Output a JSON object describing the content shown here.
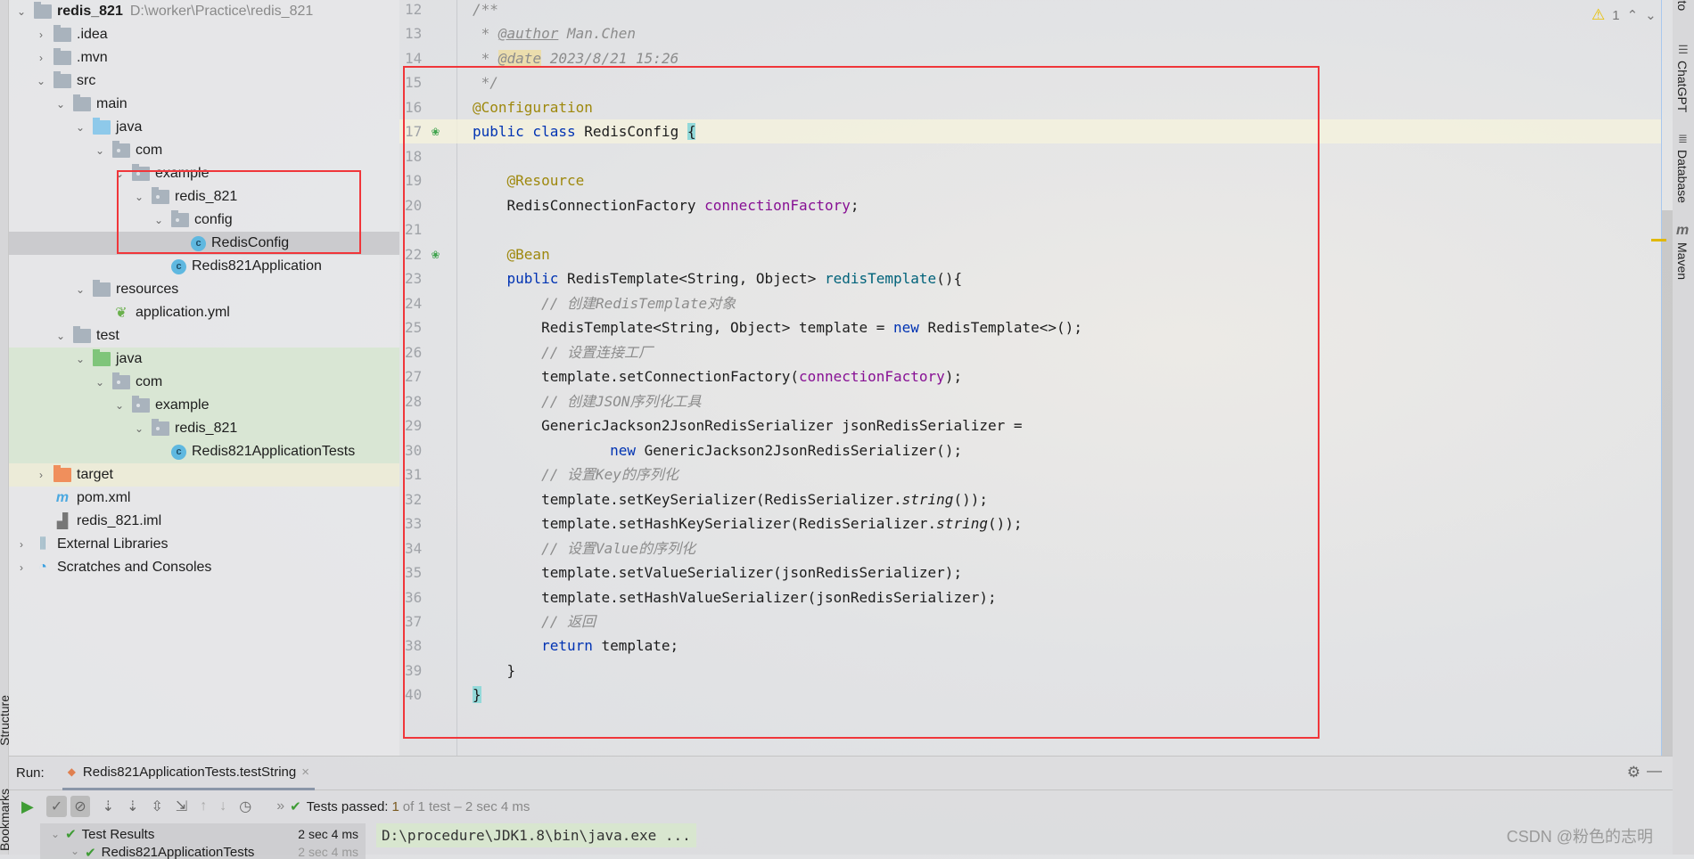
{
  "project_tree": [
    {
      "level": 0,
      "arrow": "open",
      "icon": "project",
      "label": "redis_821",
      "bold": true,
      "path": "D:\\worker\\Practice\\redis_821"
    },
    {
      "level": 1,
      "arrow": "closed",
      "icon": "folder",
      "label": ".idea"
    },
    {
      "level": 1,
      "arrow": "closed",
      "icon": "folder",
      "label": ".mvn"
    },
    {
      "level": 1,
      "arrow": "open",
      "icon": "folder",
      "label": "src"
    },
    {
      "level": 2,
      "arrow": "open",
      "icon": "folder",
      "label": "main"
    },
    {
      "level": 3,
      "arrow": "open",
      "icon": "folder-source",
      "label": "java"
    },
    {
      "level": 4,
      "arrow": "open",
      "icon": "package",
      "label": "com"
    },
    {
      "level": 5,
      "arrow": "open",
      "icon": "package",
      "label": "example"
    },
    {
      "level": 6,
      "arrow": "open",
      "icon": "package",
      "label": "redis_821"
    },
    {
      "level": 7,
      "arrow": "open",
      "icon": "package",
      "label": "config"
    },
    {
      "level": 8,
      "arrow": "none",
      "icon": "class",
      "label": "RedisConfig",
      "selected": true
    },
    {
      "level": 7,
      "arrow": "none",
      "icon": "spring-class",
      "label": "Redis821Application"
    },
    {
      "level": 3,
      "arrow": "open",
      "icon": "folder-resources",
      "label": "resources"
    },
    {
      "level": 4,
      "arrow": "none",
      "icon": "yml",
      "label": "application.yml"
    },
    {
      "level": 2,
      "arrow": "open",
      "icon": "folder",
      "label": "test"
    },
    {
      "level": 3,
      "arrow": "open",
      "icon": "folder-test",
      "label": "java",
      "bg": "green"
    },
    {
      "level": 4,
      "arrow": "open",
      "icon": "package",
      "label": "com",
      "bg": "green"
    },
    {
      "level": 5,
      "arrow": "open",
      "icon": "package",
      "label": "example",
      "bg": "green"
    },
    {
      "level": 6,
      "arrow": "open",
      "icon": "package",
      "label": "redis_821",
      "bg": "green"
    },
    {
      "level": 7,
      "arrow": "none",
      "icon": "test-class",
      "label": "Redis821ApplicationTests",
      "bg": "green"
    },
    {
      "level": 1,
      "arrow": "closed",
      "icon": "folder-excluded",
      "label": "target",
      "bg": "yellow"
    },
    {
      "level": 1,
      "arrow": "none",
      "icon": "maven",
      "label": "pom.xml"
    },
    {
      "level": 1,
      "arrow": "none",
      "icon": "iml",
      "label": "redis_821.iml"
    },
    {
      "level": 0,
      "arrow": "closed",
      "icon": "libraries",
      "label": "External Libraries"
    },
    {
      "level": 0,
      "arrow": "closed",
      "icon": "scratches",
      "label": "Scratches and Consoles"
    }
  ],
  "editor": {
    "lines": [
      {
        "n": "12",
        "tokens": [
          [
            "/**",
            "comment"
          ]
        ]
      },
      {
        "n": "13",
        "tokens": [
          [
            " * ",
            "comment"
          ],
          [
            "@author",
            "doctag"
          ],
          [
            " Man.Chen",
            "comment"
          ]
        ]
      },
      {
        "n": "14",
        "tokens": [
          [
            " * ",
            "comment"
          ],
          [
            "@date",
            "datetag"
          ],
          [
            " 2023/8/21 15:26",
            "comment"
          ]
        ]
      },
      {
        "n": "15",
        "tokens": [
          [
            " */",
            "comment"
          ]
        ]
      },
      {
        "n": "16",
        "tokens": [
          [
            "@Configuration",
            "ann"
          ]
        ]
      },
      {
        "n": "17",
        "current": true,
        "tokens": [
          [
            "public class ",
            "kw"
          ],
          [
            "RedisConfig ",
            "plain"
          ],
          [
            "{",
            "brace"
          ]
        ]
      },
      {
        "n": "18",
        "tokens": []
      },
      {
        "n": "19",
        "tokens": [
          [
            "    @Resource",
            "ann"
          ]
        ]
      },
      {
        "n": "20",
        "tokens": [
          [
            "    RedisConnectionFactory ",
            "plain"
          ],
          [
            "connectionFactory",
            "field"
          ],
          [
            ";",
            "plain"
          ]
        ]
      },
      {
        "n": "21",
        "tokens": []
      },
      {
        "n": "22",
        "tokens": [
          [
            "    @Bean",
            "ann"
          ]
        ]
      },
      {
        "n": "23",
        "tokens": [
          [
            "    public ",
            "kw"
          ],
          [
            "RedisTemplate<String, Object> ",
            "plain"
          ],
          [
            "redisTemplate",
            "method"
          ],
          [
            "(){",
            "plain"
          ]
        ]
      },
      {
        "n": "24",
        "tokens": [
          [
            "        // 创建RedisTemplate对象",
            "comment"
          ]
        ]
      },
      {
        "n": "25",
        "tokens": [
          [
            "        RedisTemplate<String, Object> template = ",
            "plain"
          ],
          [
            "new",
            "kw"
          ],
          [
            " RedisTemplate<>();",
            "plain"
          ]
        ]
      },
      {
        "n": "26",
        "tokens": [
          [
            "        // 设置连接工厂",
            "comment"
          ]
        ]
      },
      {
        "n": "27",
        "tokens": [
          [
            "        template.setConnectionFactory(",
            "plain"
          ],
          [
            "connectionFactory",
            "field"
          ],
          [
            ");",
            "plain"
          ]
        ]
      },
      {
        "n": "28",
        "tokens": [
          [
            "        // 创建JSON序列化工具",
            "comment"
          ]
        ]
      },
      {
        "n": "29",
        "tokens": [
          [
            "        GenericJackson2JsonRedisSerializer jsonRedisSerializer =",
            "plain"
          ]
        ]
      },
      {
        "n": "30",
        "tokens": [
          [
            "                ",
            "plain"
          ],
          [
            "new",
            "kw"
          ],
          [
            " GenericJackson2JsonRedisSerializer();",
            "plain"
          ]
        ]
      },
      {
        "n": "31",
        "tokens": [
          [
            "        // 设置Key的序列化",
            "comment"
          ]
        ]
      },
      {
        "n": "32",
        "tokens": [
          [
            "        template.setKeySerializer(RedisSerializer.",
            "plain"
          ],
          [
            "string",
            "static"
          ],
          [
            "());",
            "plain"
          ]
        ]
      },
      {
        "n": "33",
        "tokens": [
          [
            "        template.setHashKeySerializer(RedisSerializer.",
            "plain"
          ],
          [
            "string",
            "static"
          ],
          [
            "());",
            "plain"
          ]
        ]
      },
      {
        "n": "34",
        "tokens": [
          [
            "        // 设置Value的序列化",
            "comment"
          ]
        ]
      },
      {
        "n": "35",
        "tokens": [
          [
            "        template.setValueSerializer(jsonRedisSerializer);",
            "plain"
          ]
        ]
      },
      {
        "n": "36",
        "tokens": [
          [
            "        template.setHashValueSerializer(jsonRedisSerializer);",
            "plain"
          ]
        ]
      },
      {
        "n": "37",
        "tokens": [
          [
            "        // 返回",
            "comment"
          ]
        ]
      },
      {
        "n": "38",
        "tokens": [
          [
            "        return",
            "kw"
          ],
          [
            " template;",
            "plain"
          ]
        ]
      },
      {
        "n": "39",
        "tokens": [
          [
            "    }",
            "plain"
          ]
        ]
      },
      {
        "n": "40",
        "tokens": [
          [
            "}",
            "brace"
          ]
        ]
      }
    ],
    "warning_count": "1"
  },
  "right_tools": [
    "Bito",
    "ChatGPT",
    "Database",
    "Maven"
  ],
  "left_tools": [
    "Structure",
    "Bookmarks"
  ],
  "run": {
    "label": "Run:",
    "tab": "Redis821ApplicationTests.testString",
    "status_prefix": "Tests passed:",
    "status_count": "1",
    "status_rest": "of 1 test – 2 sec 4 ms",
    "results": [
      {
        "label": "Test Results",
        "time": "2 sec 4 ms"
      },
      {
        "label": "Redis821ApplicationTests",
        "time": "2 sec 4 ms"
      }
    ],
    "console_line": "D:\\procedure\\JDK1.8\\bin\\java.exe ..."
  },
  "watermark": "CSDN @粉色的志明",
  "colors": {
    "highlight_box": "#f0363a",
    "pass_green": "#3f9c35",
    "keyword": "#0033b3",
    "annotation": "#9e880d",
    "field": "#871094"
  }
}
